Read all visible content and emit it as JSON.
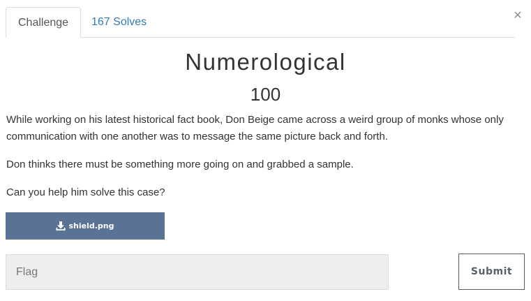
{
  "tabs": {
    "challenge_label": "Challenge",
    "solves_label": "167 Solves"
  },
  "close_label": "×",
  "challenge": {
    "name": "Numerological",
    "points": "100",
    "description": [
      "While working on his latest historical fact book, Don Beige came across a weird group of monks whose only communication with one another was to message the same picture back and forth.",
      "Don thinks there must be something more going on and grabbed a sample.",
      "Can you help him solve this case?"
    ]
  },
  "file": {
    "name": "shield.png",
    "icon": "download-icon"
  },
  "flag_input": {
    "placeholder": "Flag",
    "value": ""
  },
  "submit_label": "Submit",
  "colors": {
    "link": "#337ab7",
    "download_button": "#5a7293",
    "input_bg": "#eeeeee"
  }
}
